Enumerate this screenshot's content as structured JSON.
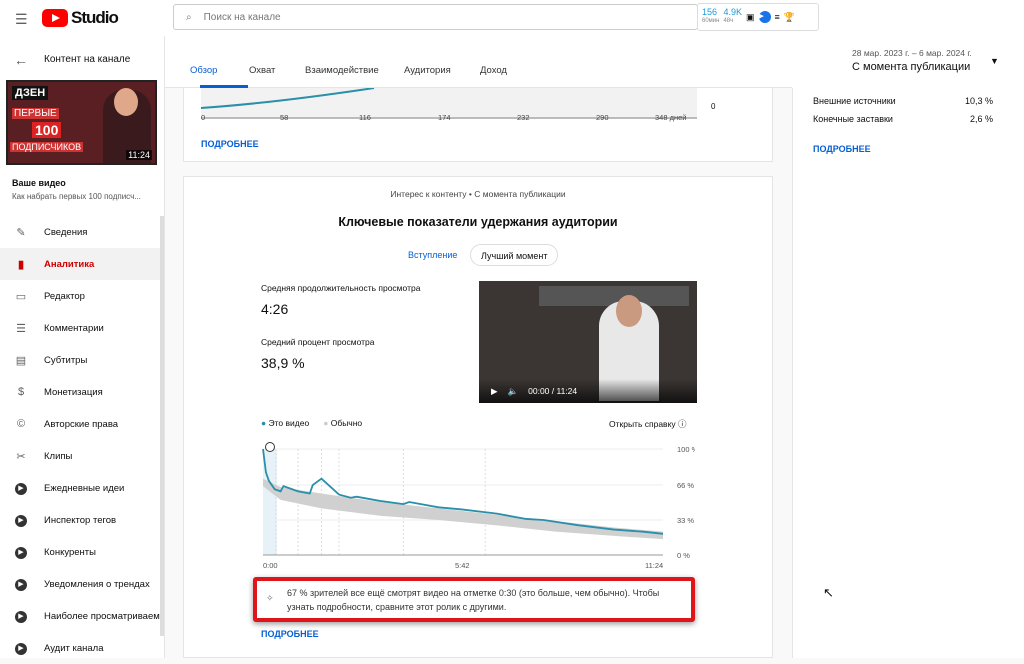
{
  "header": {
    "logo": "Studio",
    "search_placeholder": "Поиск на канале",
    "ext": {
      "v1": "156",
      "v1_sub": "60мин",
      "v2": "4.9K",
      "v2_sub": "48ч"
    }
  },
  "sidebar": {
    "back_label": "Контент на канале",
    "thumbnail": {
      "brand": "ДЗЕН",
      "line1": "ПЕРВЫЕ",
      "line2": "100",
      "line3": "ПОДПИСЧИКОВ",
      "duration": "11:24"
    },
    "your_video": "Ваше видео",
    "video_title": "Как набрать первых 100 подписч...",
    "items": [
      {
        "label": "Сведения",
        "icon": "✎"
      },
      {
        "label": "Аналитика",
        "icon": "▮"
      },
      {
        "label": "Редактор",
        "icon": "▭"
      },
      {
        "label": "Комментарии",
        "icon": "☰"
      },
      {
        "label": "Субтитры",
        "icon": "▤"
      },
      {
        "label": "Монетизация",
        "icon": "$"
      },
      {
        "label": "Авторские права",
        "icon": "©"
      },
      {
        "label": "Клипы",
        "icon": "✂"
      },
      {
        "label": "Ежедневные идеи",
        "icon": "▶"
      },
      {
        "label": "Инспектор тегов",
        "icon": "▶"
      },
      {
        "label": "Конкуренты",
        "icon": "▶"
      },
      {
        "label": "Уведомления о трендах",
        "icon": "▶"
      },
      {
        "label": "Наиболее просматриваем",
        "icon": "▶"
      },
      {
        "label": "Аудит канала",
        "icon": "▶"
      }
    ]
  },
  "tabs": [
    "Обзор",
    "Охват",
    "Взаимодействие",
    "Аудитория",
    "Доход"
  ],
  "range": {
    "dates": "28 мар. 2023 г. – 6 мар. 2024 г.",
    "period": "С момента публикации"
  },
  "top_chart": {
    "x_ticks": [
      "0",
      "58",
      "116",
      "174",
      "232",
      "290",
      "348 дней"
    ],
    "y_label": "0",
    "more": "ПОДРОБНЕЕ"
  },
  "right": {
    "rows": [
      {
        "label": "Внешние источники",
        "value": "10,3 %"
      },
      {
        "label": "Конечные заставки",
        "value": "2,6 %"
      }
    ],
    "more": "ПОДРОБНЕЕ"
  },
  "retention": {
    "subtitle": "Интерес к контенту • С момента публикации",
    "title": "Ключевые показатели удержания аудитории",
    "pills": [
      "Вступление",
      "Лучший момент"
    ],
    "avg_duration_label": "Средняя продолжительность просмотра",
    "avg_duration": "4:26",
    "avg_percent_label": "Средний процент просмотра",
    "avg_percent": "38,9 %",
    "player_time": "00:00 / 11:24",
    "legend": [
      "Это видео",
      "Обычно"
    ],
    "help": "Открыть справку",
    "insight": "67 % зрителей все ещё смотрят видео на отметке 0:30 (это больше, чем обычно). Чтобы узнать подробности, сравните этот ролик с другими.",
    "more": "ПОДРОБНЕЕ"
  },
  "chart_data": {
    "type": "line",
    "xlabel": "",
    "ylabel": "",
    "x_ticks": [
      "0:00",
      "5:42",
      "11:24"
    ],
    "y_ticks": [
      "100 %",
      "66 %",
      "33 %",
      "0 %"
    ],
    "xlim": [
      0,
      684
    ],
    "ylim": [
      0,
      100
    ],
    "series": [
      {
        "name": "Это видео",
        "color": "#2a8fa8",
        "x": [
          0,
          5,
          10,
          20,
          30,
          35,
          60,
          80,
          85,
          100,
          130,
          150,
          160,
          200,
          240,
          250,
          270,
          300,
          340,
          400,
          450,
          480,
          540,
          600,
          650,
          684
        ],
        "y": [
          100,
          78,
          70,
          62,
          60,
          65,
          60,
          58,
          66,
          72,
          57,
          54,
          55,
          51,
          48,
          50,
          48,
          45,
          43,
          39,
          34,
          33,
          28,
          24,
          22,
          20
        ]
      },
      {
        "name": "Обычно",
        "color": "#d0d0d0",
        "x": [
          0,
          30,
          100,
          200,
          300,
          400,
          500,
          600,
          684
        ],
        "upper": [
          72,
          64,
          58,
          50,
          44,
          38,
          32,
          26,
          22
        ],
        "lower": [
          65,
          52,
          44,
          37,
          33,
          28,
          22,
          18,
          15
        ]
      }
    ]
  }
}
